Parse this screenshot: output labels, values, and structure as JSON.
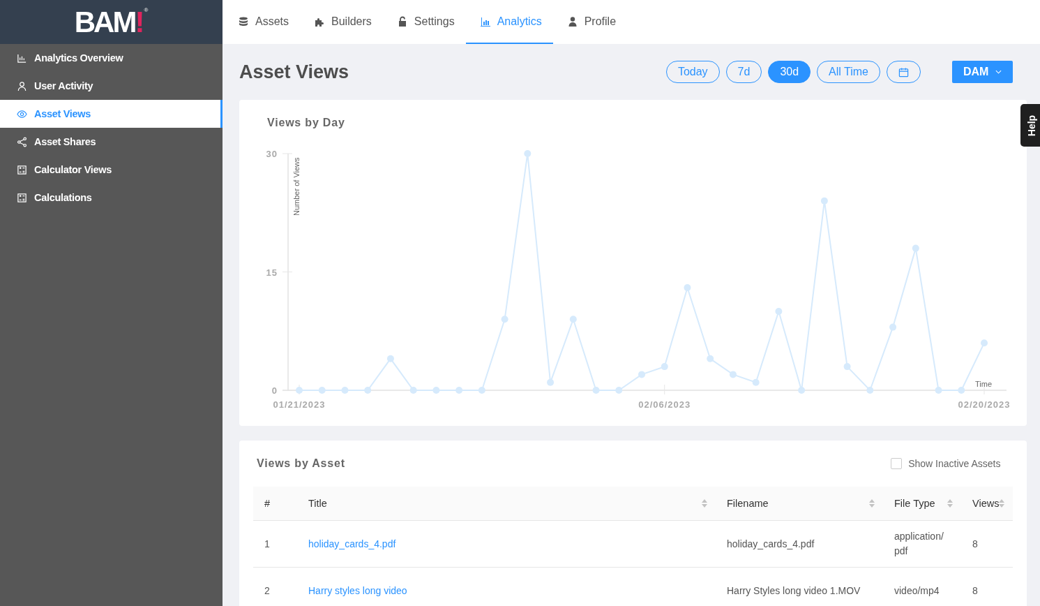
{
  "logo": {
    "text": "BAM",
    "mark": "!",
    "registered": "®"
  },
  "sidebar": {
    "items": [
      {
        "label": "Analytics Overview",
        "selected": false
      },
      {
        "label": "User Activity",
        "selected": false
      },
      {
        "label": "Asset Views",
        "selected": true
      },
      {
        "label": "Asset Shares",
        "selected": false
      },
      {
        "label": "Calculator Views",
        "selected": false
      },
      {
        "label": "Calculations",
        "selected": false
      }
    ]
  },
  "tabs": [
    {
      "label": "Assets",
      "selected": false
    },
    {
      "label": "Builders",
      "selected": false
    },
    {
      "label": "Settings",
      "selected": false
    },
    {
      "label": "Analytics",
      "selected": true
    },
    {
      "label": "Profile",
      "selected": false
    }
  ],
  "page_title": "Asset Views",
  "ranges": [
    {
      "kind": "text",
      "label": "Today",
      "selected": false
    },
    {
      "kind": "text",
      "label": "7d",
      "selected": false
    },
    {
      "kind": "text",
      "label": "30d",
      "selected": true
    },
    {
      "kind": "text",
      "label": "All Time",
      "selected": false
    },
    {
      "kind": "calendar",
      "selected": false
    }
  ],
  "source_dropdown": {
    "label": "DAM"
  },
  "help_tab": "Help",
  "views_by_day": {
    "title": "Views by Day",
    "chart_data": {
      "type": "line",
      "xlabel": "Time",
      "ylabel": "Number of Views",
      "categories": [
        "01/21/2023",
        null,
        null,
        null,
        null,
        null,
        null,
        null,
        null,
        null,
        null,
        null,
        null,
        null,
        null,
        null,
        "02/06/2023",
        null,
        null,
        null,
        null,
        null,
        null,
        null,
        null,
        null,
        null,
        null,
        null,
        null,
        "02/20/2023"
      ],
      "series": [
        {
          "color": "#d6eafc",
          "marker": "circle",
          "values": [
            0,
            0,
            0,
            0,
            4,
            0,
            0,
            0,
            0,
            9,
            30,
            1,
            9,
            0,
            0,
            2,
            3,
            13,
            4,
            2,
            1,
            10,
            0,
            24,
            3,
            0,
            8,
            18,
            0,
            0,
            6
          ]
        }
      ],
      "ylim": [
        0,
        30
      ],
      "yticks": [
        0,
        15,
        30
      ]
    }
  },
  "views_by_asset": {
    "title": "Views by Asset",
    "show_inactive": {
      "label": "Show Inactive Assets",
      "checked": false
    },
    "columns": [
      {
        "label": "#",
        "sortable": false
      },
      {
        "label": "Title",
        "sortable": true
      },
      {
        "label": "Filename",
        "sortable": true
      },
      {
        "label": "File Type",
        "sortable": true
      },
      {
        "label": "Views",
        "sortable": true
      }
    ],
    "rows": [
      {
        "number": "1",
        "title": "holiday_cards_4.pdf",
        "filename": "holiday_cards_4.pdf",
        "file_type": "application/ pdf",
        "views": "8"
      },
      {
        "number": "2",
        "title": "Harry styles long video",
        "filename": "Harry Styles long video 1.MOV",
        "file_type": "video/mp4",
        "views": "8"
      }
    ]
  }
}
